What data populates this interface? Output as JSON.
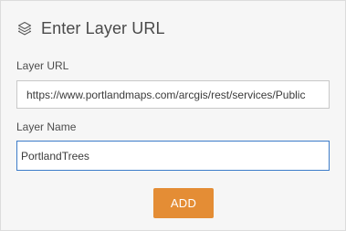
{
  "header": {
    "icon": "layers-icon",
    "title": "Enter Layer URL"
  },
  "form": {
    "layer_url": {
      "label": "Layer URL",
      "value": "https://www.portlandmaps.com/arcgis/rest/services/Public"
    },
    "layer_name": {
      "label": "Layer Name",
      "value": "PortlandTrees"
    },
    "add_label": "ADD"
  },
  "colors": {
    "accent": "#e48d35",
    "focus_border": "#3d7cc9",
    "panel_background": "#f6f6f6"
  }
}
